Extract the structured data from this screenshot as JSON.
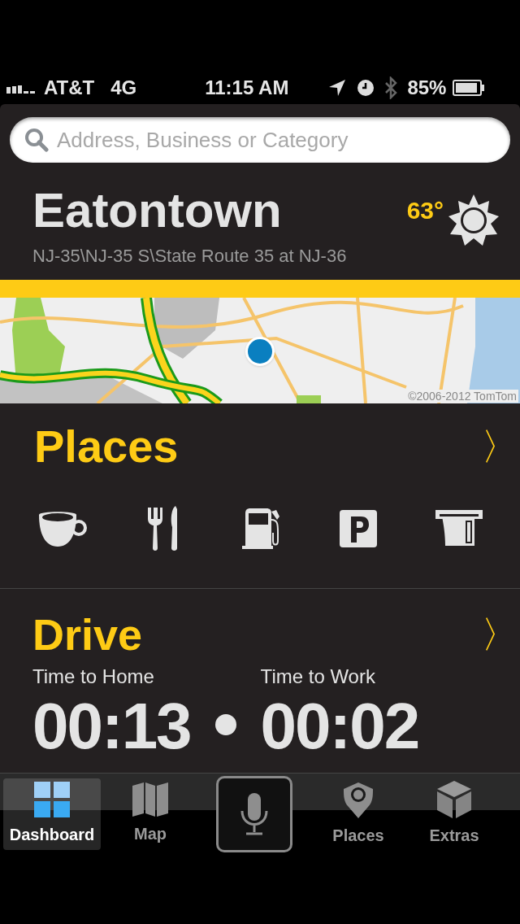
{
  "status_bar": {
    "carrier": "AT&T",
    "network": "4G",
    "time": "11:15 AM",
    "battery": "85%"
  },
  "search": {
    "placeholder": "Address, Business or Category"
  },
  "location": {
    "city": "Eatontown",
    "road": "NJ-35\\NJ-35 S\\State Route 35 at NJ-36",
    "temperature": "63°"
  },
  "map": {
    "copyright": "©2006-2012 TomTom"
  },
  "places": {
    "title": "Places",
    "chevron": "〉"
  },
  "drive": {
    "title": "Drive",
    "chevron": "〉",
    "routes": [
      {
        "label": "Time to Home",
        "time": "00:13"
      },
      {
        "label": "Time to Work",
        "time": "00:02"
      }
    ]
  },
  "tabs": [
    {
      "kind": "dashboard",
      "label": "Dashboard",
      "selected": true
    },
    {
      "kind": "map",
      "label": "Map",
      "selected": false
    },
    {
      "kind": "voice",
      "selected": false
    },
    {
      "kind": "places",
      "label": "Places",
      "selected": false
    },
    {
      "kind": "extras",
      "label": "Extras",
      "selected": false
    }
  ]
}
